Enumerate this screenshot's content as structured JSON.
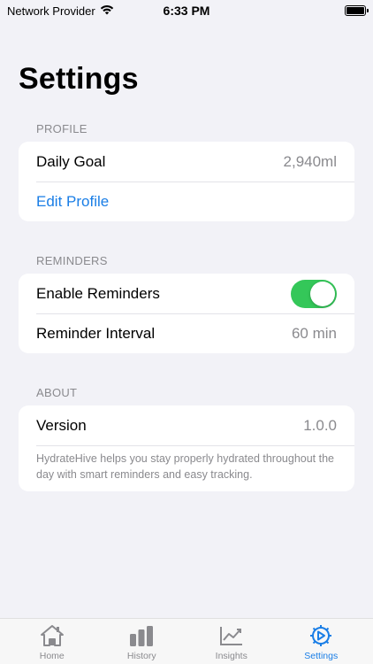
{
  "status_bar": {
    "carrier": "Network Provider",
    "time": "6:33 PM"
  },
  "page": {
    "title": "Settings"
  },
  "sections": {
    "profile": {
      "header": "PROFILE",
      "daily_goal_label": "Daily Goal",
      "daily_goal_value": "2,940ml",
      "edit_profile_label": "Edit Profile"
    },
    "reminders": {
      "header": "REMINDERS",
      "enable_label": "Enable Reminders",
      "enabled": true,
      "interval_label": "Reminder Interval",
      "interval_value": "60 min"
    },
    "about": {
      "header": "ABOUT",
      "version_label": "Version",
      "version_value": "1.0.0",
      "description": "HydrateHive helps you stay properly hydrated throughout the day with smart reminders and easy tracking."
    }
  },
  "tab_bar": {
    "tabs": [
      {
        "label": "Home",
        "icon": "house-icon",
        "active": false
      },
      {
        "label": "History",
        "icon": "bar-chart-icon",
        "active": false
      },
      {
        "label": "Insights",
        "icon": "trend-chart-icon",
        "active": false
      },
      {
        "label": "Settings",
        "icon": "gear-icon",
        "active": true
      }
    ]
  },
  "colors": {
    "accent": "#1a7ee6",
    "toggle_on": "#34c759",
    "background": "#f2f2f7",
    "secondary_text": "#8a8a8e"
  }
}
